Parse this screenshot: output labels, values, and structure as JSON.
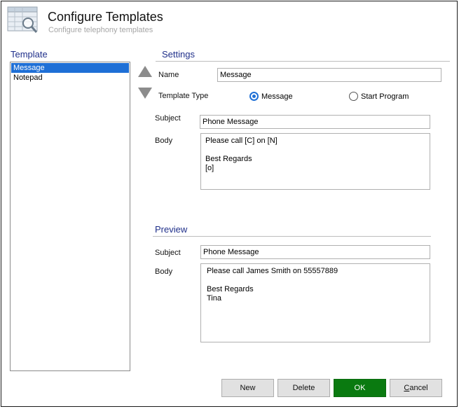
{
  "header": {
    "title": "Configure Templates",
    "subtitle": "Configure telephony templates",
    "icon": "spreadsheet-search-icon"
  },
  "template_panel": {
    "label": "Template",
    "items": [
      {
        "label": "Message",
        "selected": true
      },
      {
        "label": "Notepad",
        "selected": false
      }
    ]
  },
  "move_buttons": {
    "up_icon": "arrow-up-icon",
    "down_icon": "arrow-down-icon"
  },
  "settings": {
    "label": "Settings",
    "name_label": "Name",
    "name_value": "Message",
    "template_type_label": "Template Type",
    "type_options": [
      {
        "label": "Message",
        "checked": true
      },
      {
        "label": "Start Program",
        "checked": false
      }
    ],
    "subject_label": "Subject",
    "subject_value": "Phone Message",
    "body_label": "Body",
    "body_value": "Please call [C] on [N]\n\nBest Regards\n[o]"
  },
  "preview": {
    "label": "Preview",
    "subject_label": "Subject",
    "subject_value": "Phone Message",
    "body_label": "Body",
    "body_value": "Please call James Smith on 55557889\n\nBest Regards\nTina"
  },
  "buttons": {
    "new": "New",
    "delete": "Delete",
    "ok": "OK",
    "cancel_first": "C",
    "cancel_rest": "ancel"
  },
  "colors": {
    "accent": "#1e6fd6",
    "ok_button": "#0a7a10",
    "section_label": "#1f2f8a"
  }
}
